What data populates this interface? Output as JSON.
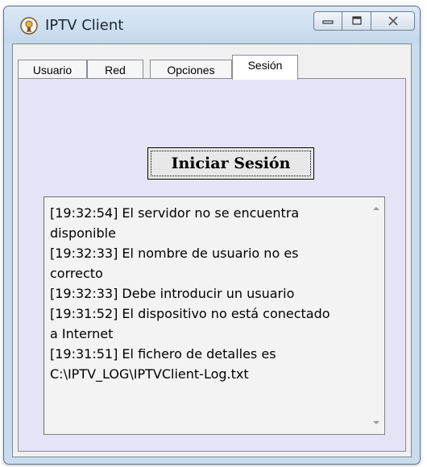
{
  "window": {
    "title": "IPTV Client",
    "icon": "iptv-app-icon"
  },
  "titlebar_buttons": [
    {
      "name": "minimize",
      "icon": "minimize-icon"
    },
    {
      "name": "maximize",
      "icon": "maximize-icon"
    },
    {
      "name": "close",
      "icon": "close-icon"
    }
  ],
  "tabs": [
    {
      "label": "Usuario",
      "active": false
    },
    {
      "label": "Red",
      "active": false
    },
    {
      "label": "Opciones",
      "active": false
    },
    {
      "label": "Sesión",
      "active": true
    }
  ],
  "session": {
    "login_button_label": "Iniciar Sesión"
  },
  "log": {
    "lines": [
      "[19:32:54] El servidor no se encuentra",
      "disponible",
      "[19:32:33] El nombre de usuario no es",
      "correcto",
      "[19:32:33] Debe introducir un usuario",
      "[19:31:52] El dispositivo no está conectado",
      "a Internet",
      "[19:31:51] El fichero de detalles es",
      "C:\\IPTV_LOG\\IPTVClient-Log.txt"
    ]
  },
  "colors": {
    "window_frame": "#c9dcee",
    "client_bg": "#f0f0f0",
    "tab_panel_bg": "#e4e4f6",
    "log_bg": "#f3f3f3"
  }
}
